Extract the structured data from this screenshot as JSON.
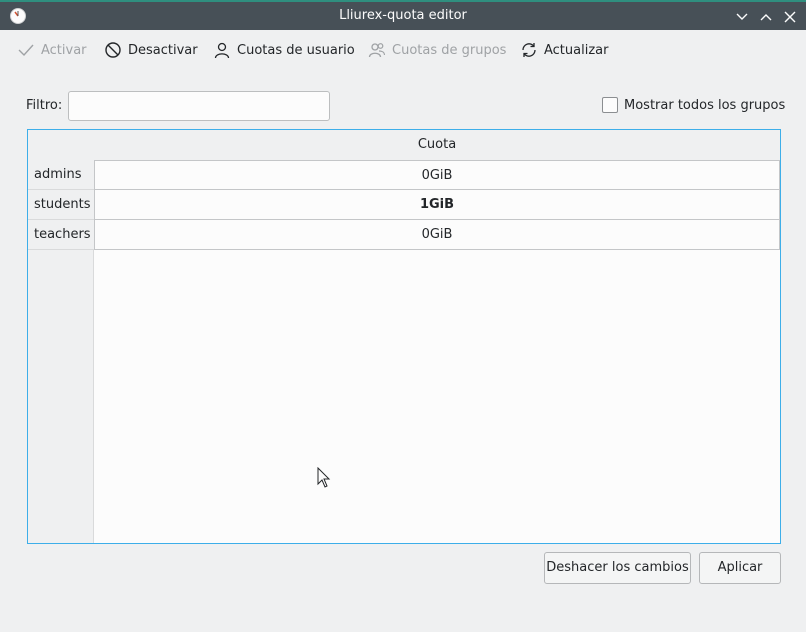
{
  "window": {
    "title": "Lliurex-quota editor"
  },
  "toolbar": {
    "activate": "Activar",
    "deactivate": "Desactivar",
    "user_quotas": "Cuotas de usuario",
    "group_quotas": "Cuotas de grupos",
    "refresh": "Actualizar"
  },
  "filter": {
    "label": "Filtro:",
    "value": ""
  },
  "show_all_groups": {
    "label": "Mostrar todos los grupos",
    "checked": false
  },
  "table": {
    "column_header": "Cuota",
    "rows": [
      {
        "group": "admins",
        "quota": "0GiB"
      },
      {
        "group": "students",
        "quota": "1GiB"
      },
      {
        "group": "teachers",
        "quota": "0GiB"
      }
    ]
  },
  "buttons": {
    "undo": "Deshacer los cambios",
    "apply": "Aplicar"
  },
  "colors": {
    "titlebar": "#475057",
    "accent": "#3daee9",
    "background": "#eff0f1"
  }
}
